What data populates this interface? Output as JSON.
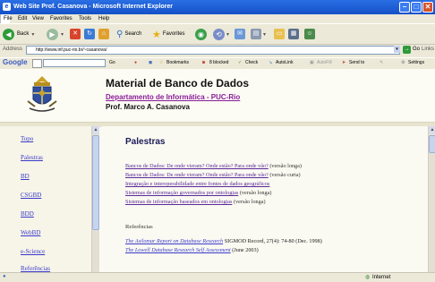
{
  "window": {
    "title": "Web Site Prof. Casanova - Microsoft Internet Explorer"
  },
  "menu": [
    "File",
    "Edit",
    "View",
    "Favorites",
    "Tools",
    "Help"
  ],
  "toolbar": {
    "back": "Back",
    "search": "Search",
    "favorites": "Favorites"
  },
  "address": {
    "label": "Address",
    "url": "http://www.inf.puc-rio.br/~casanova/",
    "go": "Go",
    "links": "Links"
  },
  "googlebar": {
    "logo": "Google",
    "go": "Go",
    "bookmarks": "Bookmarks",
    "blocked": "8 blocked",
    "check": "Check",
    "autolink": "AutoLink",
    "autofill": "AutoFill",
    "sendto": "Send to",
    "settings": "Settings"
  },
  "header": {
    "title": "Material de Banco de Dados",
    "department": "Departamento de Informática - PUC-Rio",
    "professor": "Prof. Marco A. Casanova"
  },
  "nav": [
    "Topo",
    "Palestras",
    "BD",
    "CSGBD",
    "BDD",
    "WebBD",
    "e-Science",
    "Referências"
  ],
  "main": {
    "heading": "Palestras",
    "links": [
      {
        "text": "Bancos de Dados: De onde vieram? Onde estão? Para onde vão?",
        "note": "(versão longa)"
      },
      {
        "text": "Bancos de Dados: De onde vieram? Onde estão? Para onde vão?",
        "note": "(versão curta)"
      },
      {
        "text": "Integração e interoperabilidade entre fontes de dados geográficos",
        "note": ""
      },
      {
        "text": "Sistemas de informação governados por ontologias",
        "note": "(versão longa)"
      },
      {
        "text": "Sistemas de informação baseados em ontologias",
        "note": "(versão longa)"
      }
    ],
    "refs_label": "Referências",
    "refs": [
      {
        "link": "The Asilomar Report on Database Research",
        "rest": "SIGMOD Record, 27(4): 74-80 (Dec. 1998)"
      },
      {
        "link": "The Lowell Database Research Self Assessment",
        "rest": "(June 2003)"
      }
    ]
  },
  "status": {
    "zone": "Internet"
  }
}
